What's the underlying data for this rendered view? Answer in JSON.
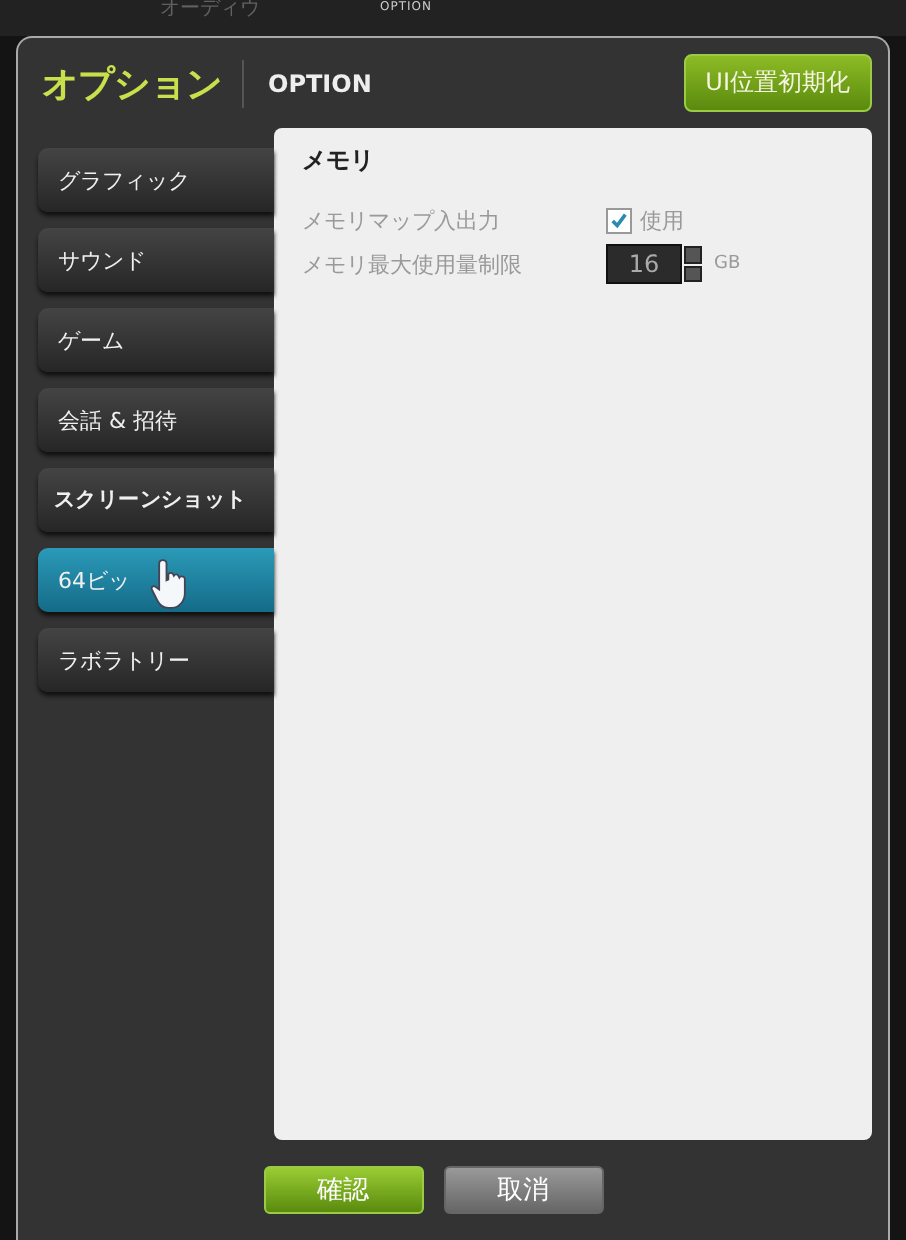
{
  "background": {
    "labels": [
      "オーディウ",
      "OPTION"
    ]
  },
  "window": {
    "title": "オプション",
    "subtitle": "OPTION",
    "reset_button": "UI位置初期化"
  },
  "sidebar": {
    "items": [
      {
        "label": "グラフィック",
        "selected": false,
        "bold": false
      },
      {
        "label": "サウンド",
        "selected": false,
        "bold": false
      },
      {
        "label": "ゲーム",
        "selected": false,
        "bold": false
      },
      {
        "label": "会話 & 招待",
        "selected": false,
        "bold": false
      },
      {
        "label": "スクリーンショット",
        "selected": false,
        "bold": true
      },
      {
        "label": "64ビッ",
        "selected": true,
        "bold": false
      },
      {
        "label": "ラボラトリー",
        "selected": false,
        "bold": false
      }
    ]
  },
  "panel": {
    "heading": "メモリ",
    "rows": [
      {
        "kind": "checkbox",
        "label": "メモリマップ入出力",
        "checked": true,
        "text": "使用"
      },
      {
        "kind": "spinner",
        "label": "メモリ最大使用量制限",
        "value": "16",
        "unit": "GB"
      }
    ]
  },
  "buttons": [
    {
      "label": "確認",
      "kind": "primary"
    },
    {
      "label": "取消",
      "kind": "secondary"
    }
  ]
}
